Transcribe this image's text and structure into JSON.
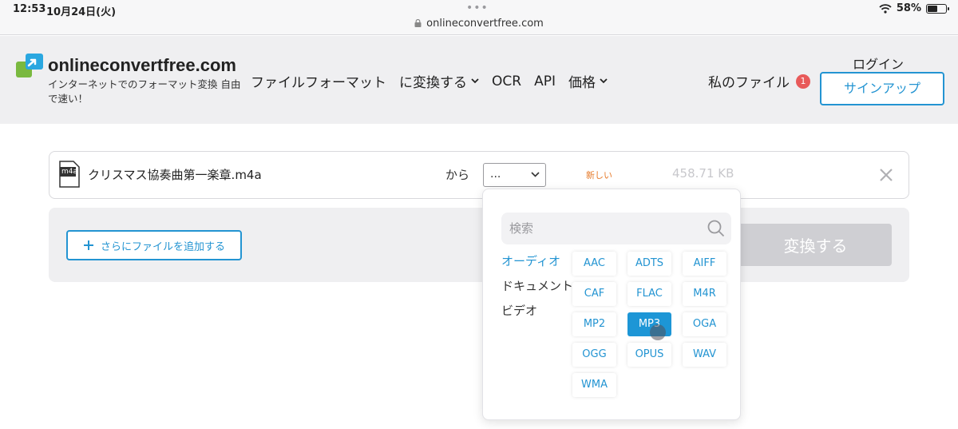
{
  "status_bar": {
    "time": "12:53",
    "date": "10月24日(火)",
    "url": "onlineconvertfree.com",
    "battery": "58%",
    "battery_level": 0.58
  },
  "header": {
    "brand": "onlineconvertfree.com",
    "tagline": "インターネットでのフォーマット変換 自由で速い！",
    "nav": [
      "ファイルフォーマット",
      "に変換する",
      "OCR",
      "API",
      "価格"
    ],
    "my_files": "私のファイル",
    "my_files_count": "1",
    "login": "ログイン",
    "signup": "サインアップ"
  },
  "file": {
    "icon_label": "m4a",
    "name": "クリスマス協奏曲第一楽章.m4a",
    "from_label": "から",
    "format_value": "...",
    "new_tag": "新しい",
    "size": "458.71 KB"
  },
  "actions": {
    "add_more": "さらにファイルを追加する",
    "convert": "変換する"
  },
  "dropdown": {
    "search_placeholder": "検索",
    "categories": [
      "オーディオ",
      "ドキュメント",
      "ビデオ"
    ],
    "active_category": "オーディオ",
    "formats": [
      "AAC",
      "ADTS",
      "AIFF",
      "CAF",
      "FLAC",
      "M4R",
      "MP2",
      "MP3",
      "OGA",
      "OGG",
      "OPUS",
      "WAV",
      "WMA"
    ],
    "selected_format": "MP3"
  },
  "colors": {
    "accent": "#2394d2",
    "selected": "#1d96d6",
    "badge": "#e85a5a",
    "new_tag": "#e67a2a"
  }
}
